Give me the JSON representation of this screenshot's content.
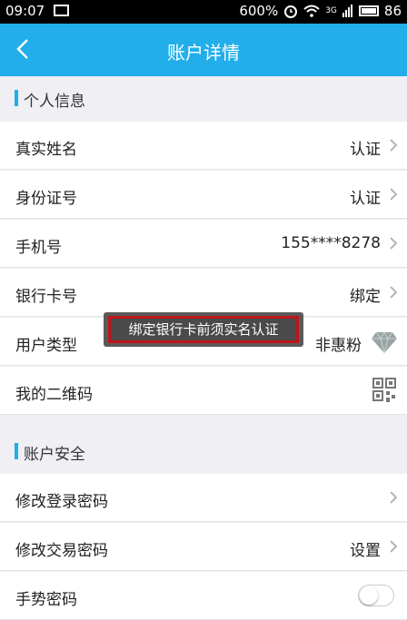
{
  "status_bar": {
    "time": "09:07",
    "zoom": "600%",
    "network": "3G",
    "battery_pct": "86"
  },
  "nav": {
    "title": "账户详情"
  },
  "sections": {
    "personal": {
      "title": "个人信息",
      "rows": [
        {
          "label": "真实姓名",
          "value": "认证"
        },
        {
          "label": "身份证号",
          "value": "认证"
        },
        {
          "label": "手机号",
          "value": "155****8278"
        },
        {
          "label": "银行卡号",
          "value": "绑定"
        },
        {
          "label": "用户类型",
          "value": "非惠粉"
        },
        {
          "label": "我的二维码",
          "value": ""
        }
      ]
    },
    "security": {
      "title": "账户安全",
      "rows": [
        {
          "label": "修改登录密码",
          "value": ""
        },
        {
          "label": "修改交易密码",
          "value": "设置"
        },
        {
          "label": "手势密码",
          "value": ""
        }
      ]
    }
  },
  "toast": {
    "text": "绑定银行卡前须实名认证"
  },
  "colors": {
    "accent": "#21aeea",
    "toast_border": "#c0141b"
  }
}
